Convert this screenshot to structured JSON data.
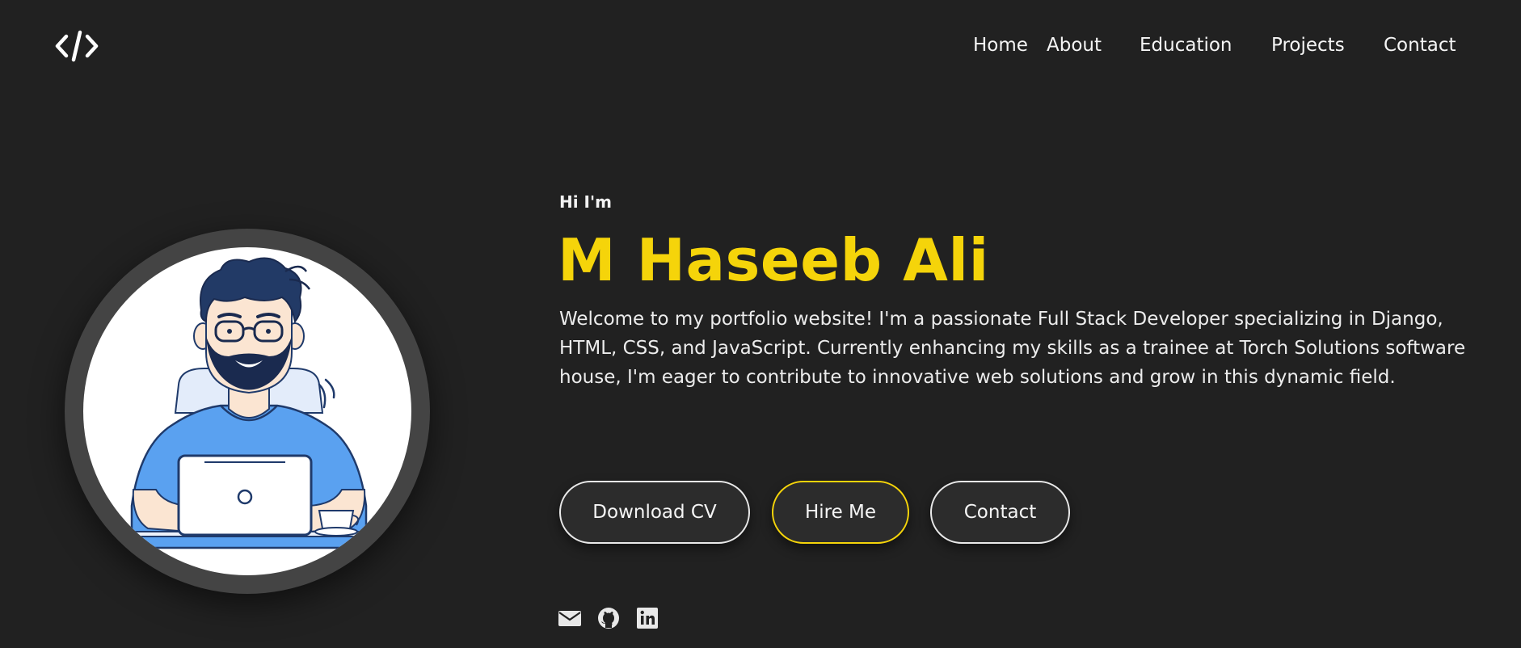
{
  "header": {
    "logo_icon": "code-brackets-icon",
    "nav": [
      "Home",
      "About",
      "Education",
      "Projects",
      "Contact"
    ]
  },
  "hero": {
    "greeting": "Hi I'm",
    "name": "M Haseeb Ali",
    "intro": "Welcome to my portfolio website! I'm a passionate Full Stack Developer specializing in Django, HTML, CSS, and JavaScript. Currently enhancing my skills as a trainee at Torch Solutions software house, I'm eager to contribute to innovative web solutions and grow in this dynamic field.",
    "buttons": {
      "download_cv": "Download CV",
      "hire_me": "Hire Me",
      "contact": "Contact"
    },
    "social_icons": [
      "mail-icon",
      "github-icon",
      "linkedin-icon"
    ]
  },
  "colors": {
    "background": "#212121",
    "accent": "#f5d40a",
    "avatar_ring": "#444444",
    "shirt": "#5aa1f0"
  }
}
